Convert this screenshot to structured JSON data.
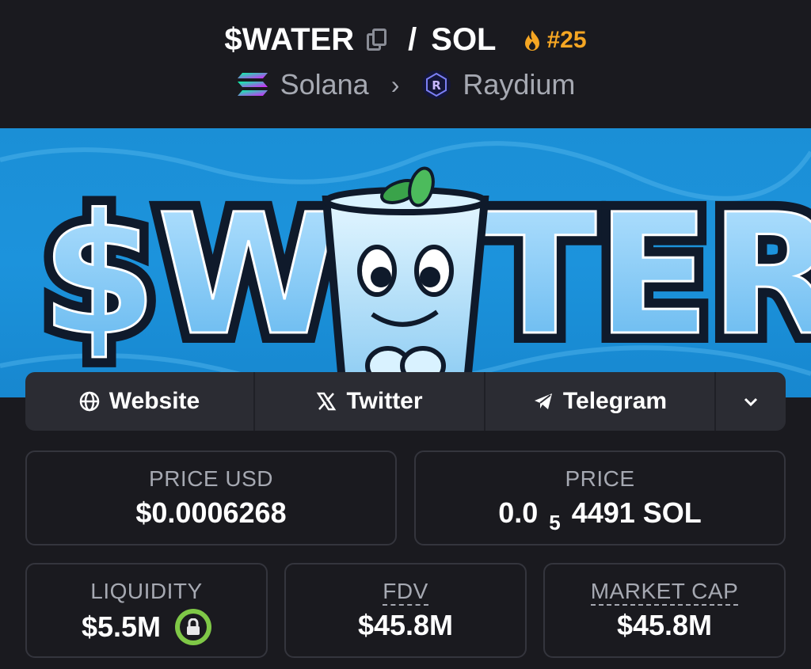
{
  "header": {
    "token_symbol": "$WATER",
    "separator": "/",
    "quote_symbol": "SOL",
    "rank": "#25",
    "chain": "Solana",
    "dex": "Raydium",
    "icons": [
      "copy-icon",
      "flame-icon",
      "solana-icon",
      "chevron-right-icon",
      "raydium-icon"
    ]
  },
  "banner": {
    "alt_text": "$WATER"
  },
  "links": {
    "website": "Website",
    "twitter": "Twitter",
    "telegram": "Telegram",
    "icons": [
      "globe-icon",
      "x-icon",
      "telegram-icon",
      "chevron-down-icon"
    ]
  },
  "stats": {
    "price_usd": {
      "label": "PRICE USD",
      "value": "$0.0006268"
    },
    "price": {
      "label": "PRICE",
      "value_prefix": "0.0",
      "value_subscript": "5",
      "value_suffix": "4491 SOL"
    },
    "liquidity": {
      "label": "LIQUIDITY",
      "value": "$5.5M"
    },
    "fdv": {
      "label": "FDV",
      "value": "$45.8M"
    },
    "market_cap": {
      "label": "MARKET CAP",
      "value": "$45.8M"
    }
  },
  "colors": {
    "background": "#1a1a1f",
    "panel": "#2b2c33",
    "rank_accent": "#f5a623",
    "lock_green": "#7fc847",
    "banner_blue": "#1b8fd6"
  }
}
